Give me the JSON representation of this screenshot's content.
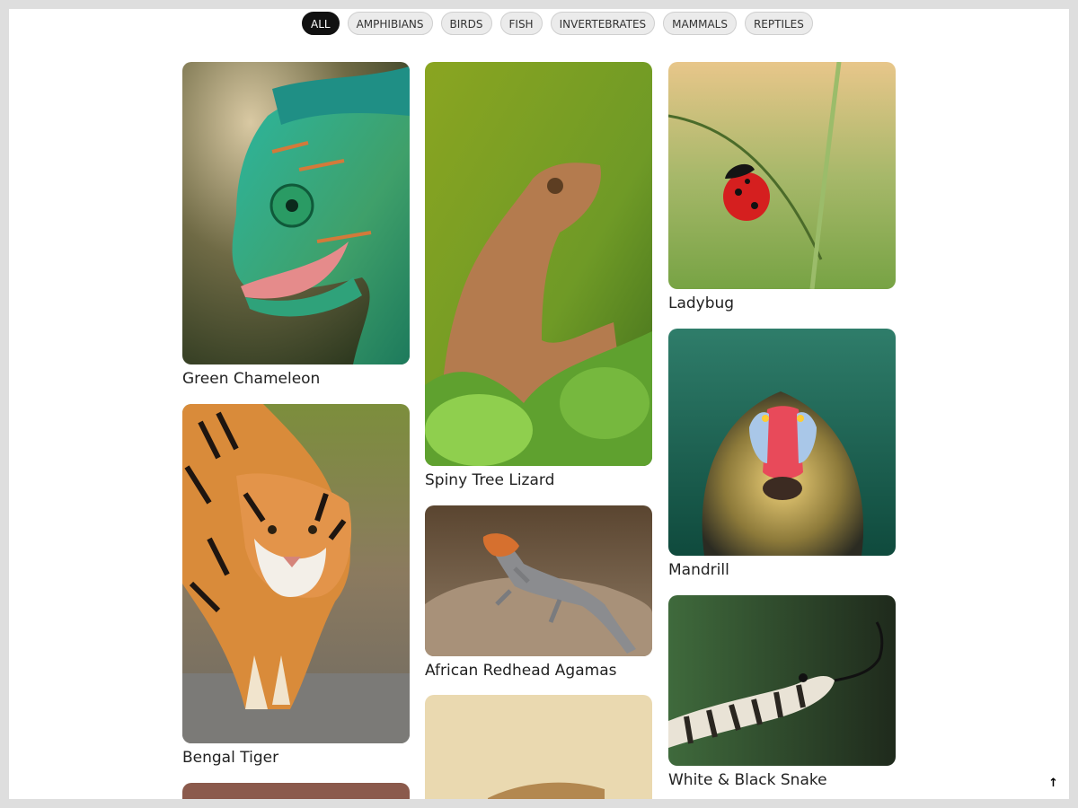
{
  "filters": [
    {
      "label": "ALL",
      "active": true
    },
    {
      "label": "AMPHIBIANS"
    },
    {
      "label": "BIRDS"
    },
    {
      "label": "FISH"
    },
    {
      "label": "INVERTEBRATES"
    },
    {
      "label": "MAMMALS"
    },
    {
      "label": "REPTILES"
    }
  ],
  "cards": {
    "chameleon": "Green Chameleon",
    "tiger": "Bengal Tiger",
    "lizard": "Spiny Tree Lizard",
    "agama": "African Redhead Agamas",
    "ladybug": "Ladybug",
    "mandrill": "Mandrill",
    "snake": "White & Black Snake"
  },
  "scroll_top_icon": "arrow-up-icon"
}
